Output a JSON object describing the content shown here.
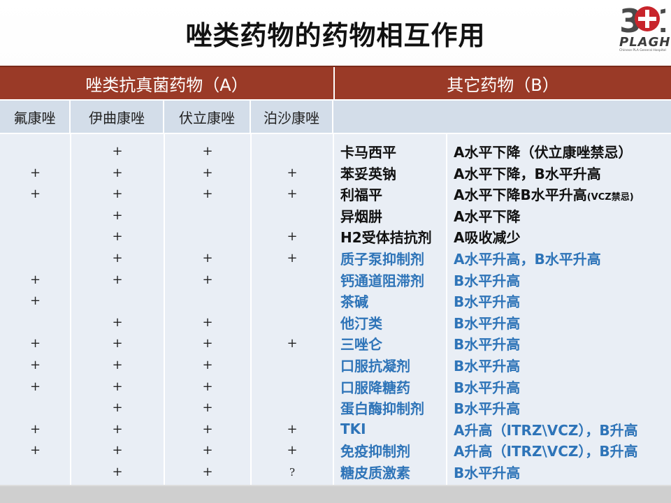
{
  "title": "唑类药物的药物相互作用",
  "logo": {
    "digits": "301",
    "brand": "PLAGH",
    "sub": "Chinese PLA General Hospital"
  },
  "header": {
    "group_a": "唑类抗真菌药物（A）",
    "group_b": "其它药物（B）"
  },
  "columns": [
    "氟康唑",
    "伊曲康唑",
    "伏立康唑",
    "泊沙康唑"
  ],
  "rows": [
    {
      "c": [
        "",
        "+",
        "+",
        ""
      ],
      "drug": "卡马西平",
      "effect": "A水平下降（伏立康唑禁忌）",
      "effect_note": "",
      "color": "black"
    },
    {
      "c": [
        "+",
        "+",
        "+",
        "+"
      ],
      "drug": "苯妥英钠",
      "effect": "A水平下降，B水平升高",
      "effect_note": "",
      "color": "black"
    },
    {
      "c": [
        "+",
        "+",
        "+",
        "+"
      ],
      "drug": "利福平",
      "effect": "A水平下降B水平升高",
      "effect_note": "(VCZ禁忌)",
      "color": "black"
    },
    {
      "c": [
        "",
        "+",
        "",
        ""
      ],
      "drug": "异烟肼",
      "effect": "A水平下降",
      "effect_note": "",
      "color": "black"
    },
    {
      "c": [
        "",
        "+",
        "",
        "+"
      ],
      "drug": "H2受体拮抗剂",
      "effect": "A吸收减少",
      "effect_note": "",
      "color": "black"
    },
    {
      "c": [
        "",
        "+",
        "+",
        "+"
      ],
      "drug": "质子泵抑制剂",
      "effect": "A水平升高，B水平升高",
      "effect_note": "",
      "color": "blue"
    },
    {
      "c": [
        "+",
        "+",
        "+",
        ""
      ],
      "drug": "钙通道阻滞剂",
      "effect": "B水平升高",
      "effect_note": "",
      "color": "blue"
    },
    {
      "c": [
        "+",
        "",
        "",
        ""
      ],
      "drug": "茶碱",
      "effect": "B水平升高",
      "effect_note": "",
      "color": "blue"
    },
    {
      "c": [
        "",
        "+",
        "+",
        ""
      ],
      "drug": "他汀类",
      "effect": "B水平升高",
      "effect_note": "",
      "color": "blue"
    },
    {
      "c": [
        "+",
        "+",
        "+",
        "+"
      ],
      "drug": "三唑仑",
      "effect": "B水平升高",
      "effect_note": "",
      "color": "blue"
    },
    {
      "c": [
        "+",
        "+",
        "+",
        ""
      ],
      "drug": "口服抗凝剂",
      "effect": "B水平升高",
      "effect_note": "",
      "color": "blue"
    },
    {
      "c": [
        "+",
        "+",
        "+",
        ""
      ],
      "drug": "口服降糖药",
      "effect": "B水平升高",
      "effect_note": "",
      "color": "blue"
    },
    {
      "c": [
        "",
        "+",
        "+",
        ""
      ],
      "drug": "蛋白酶抑制剂",
      "effect": "B水平升高",
      "effect_note": "",
      "color": "blue"
    },
    {
      "c": [
        "+",
        "+",
        "+",
        "+"
      ],
      "drug": "TKI",
      "effect": "A升高（ITRZ\\VCZ），B升高",
      "effect_note": "",
      "color": "blue"
    },
    {
      "c": [
        "+",
        "+",
        "+",
        "+"
      ],
      "drug": "免疫抑制剂",
      "effect": "A升高（ITRZ\\VCZ），B升高",
      "effect_note": "",
      "color": "blue"
    },
    {
      "c": [
        "",
        "+",
        "+",
        "?"
      ],
      "drug": "糖皮质激素",
      "effect": "B水平升高",
      "effect_note": "",
      "color": "blue"
    }
  ]
}
